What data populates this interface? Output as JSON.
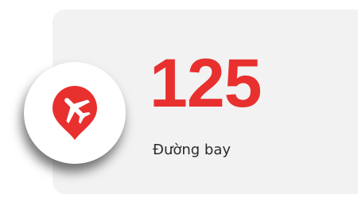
{
  "stat": {
    "value": "125",
    "label": "Đường bay"
  },
  "badge": {
    "icon": "airplane-location-pin-icon"
  },
  "colors": {
    "accent": "#e8302e",
    "card_background": "#f2f2f2",
    "label_text": "#2b2b2b",
    "badge_background": "#ffffff"
  }
}
